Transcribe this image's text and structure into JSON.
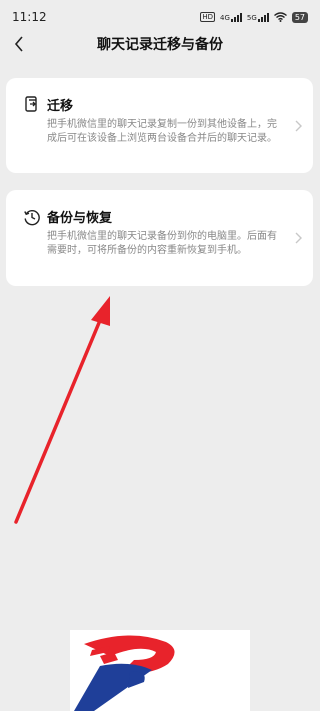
{
  "status": {
    "time": "11:12",
    "hd_label": "HD",
    "net_4g": "4G",
    "net_5g": "5G",
    "battery": "57"
  },
  "nav": {
    "back_icon": "chevron-left-icon",
    "title": "聊天记录迁移与备份"
  },
  "options": [
    {
      "icon": "phone-transfer-icon",
      "title": "迁移",
      "description": "把手机微信里的聊天记录复制一份到其他设备上，完成后可在该设备上浏览两台设备合并后的聊天记录。"
    },
    {
      "icon": "clock-restore-icon",
      "title": "备份与恢复",
      "description": "把手机微信里的聊天记录备份到你的电脑里。后面有需要时，可将所备份的内容重新恢复到手机。"
    }
  ],
  "overlay": {
    "arrow_color": "#e8232b",
    "logo_colors": [
      "#e8232b",
      "#1f3f99"
    ]
  }
}
